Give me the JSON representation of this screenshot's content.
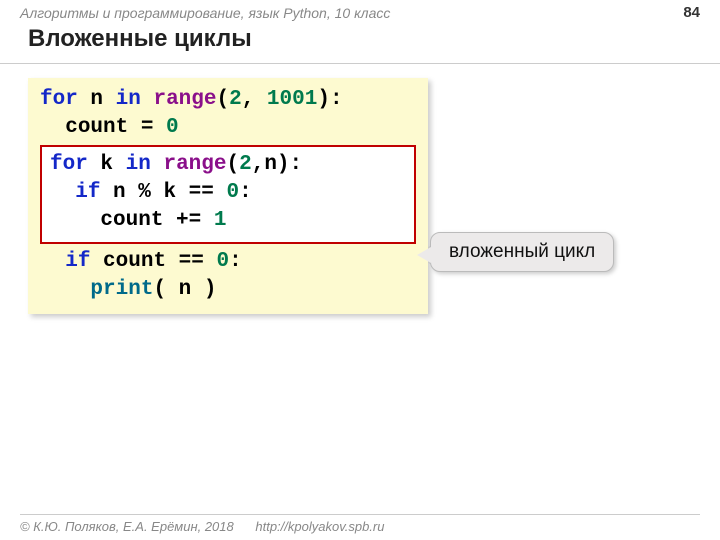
{
  "header": {
    "course": "Алгоритмы и программирование, язык Python, 10 класс",
    "page": "84"
  },
  "title": "Вложенные циклы",
  "code": {
    "l1": {
      "for": "for",
      "n": "n",
      "in": "in",
      "range": "range",
      "open": "(",
      "a": "2",
      "comma": ", ",
      "b": "1001",
      "close": "):"
    },
    "l2": {
      "indent": "  ",
      "count": "count",
      "eq": " = ",
      "zero": "0"
    },
    "l3": {
      "for": "for",
      "k": "k",
      "in": "in",
      "range": "range",
      "open": "(",
      "a": "2",
      "comma": ",",
      "n": "n",
      "close": "):"
    },
    "l4": {
      "indent": "  ",
      "if": "if",
      "sp": " ",
      "n": "n",
      "mod": " % ",
      "k": "k",
      "eqeq": " == ",
      "zero": "0",
      "colon": ":"
    },
    "l5": {
      "indent": "    ",
      "count": "count",
      "pluseq": " += ",
      "one": "1"
    },
    "l6": {
      "indent": "  ",
      "if": "if",
      "sp": " ",
      "count": "count",
      "eqeq": " == ",
      "zero": "0",
      "colon": ":"
    },
    "l7": {
      "indent": "    ",
      "print": "print",
      "open": "( ",
      "n": "n",
      "close": " )"
    }
  },
  "callout": "вложенный цикл",
  "footer": {
    "copyright": "© К.Ю. Поляков, Е.А. Ерёмин, 2018",
    "url": "http://kpolyakov.spb.ru"
  }
}
